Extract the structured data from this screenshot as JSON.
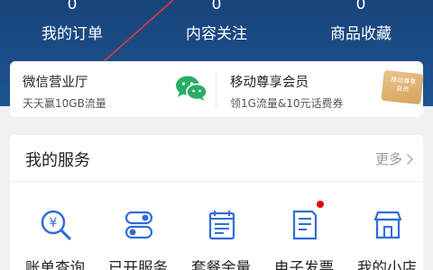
{
  "stats": [
    {
      "count": "0",
      "label": "我的订单"
    },
    {
      "count": "0",
      "label": "内容关注"
    },
    {
      "count": "0",
      "label": "商品收藏"
    }
  ],
  "promos": {
    "wechat": {
      "title": "微信营业厅",
      "subtitle": "天天赢10GB流量",
      "icon": "wechat-icon"
    },
    "vip": {
      "title": "移动尊享会员",
      "subtitle": "领1G流量&10元话费券",
      "card_line1": "移动尊享",
      "card_line2": "会员",
      "icon": "membership-card-icon"
    }
  },
  "services": {
    "title": "我的服务",
    "more_label": "更多",
    "items": [
      {
        "label": "账单查询",
        "icon": "bill-search-icon"
      },
      {
        "label": "已开服务",
        "icon": "toggle-icon"
      },
      {
        "label": "套餐余量",
        "icon": "package-balance-icon"
      },
      {
        "label": "电子发票",
        "icon": "invoice-icon",
        "badge": true
      },
      {
        "label": "我的小店",
        "icon": "shop-icon"
      }
    ]
  },
  "colors": {
    "header": "#1e5493",
    "accent_blue": "#2f6dd9",
    "wechat_green": "#2aae67",
    "gold": "#d6a35d",
    "badge_red": "#e60012",
    "annotation_arrow": "#e5383b"
  }
}
